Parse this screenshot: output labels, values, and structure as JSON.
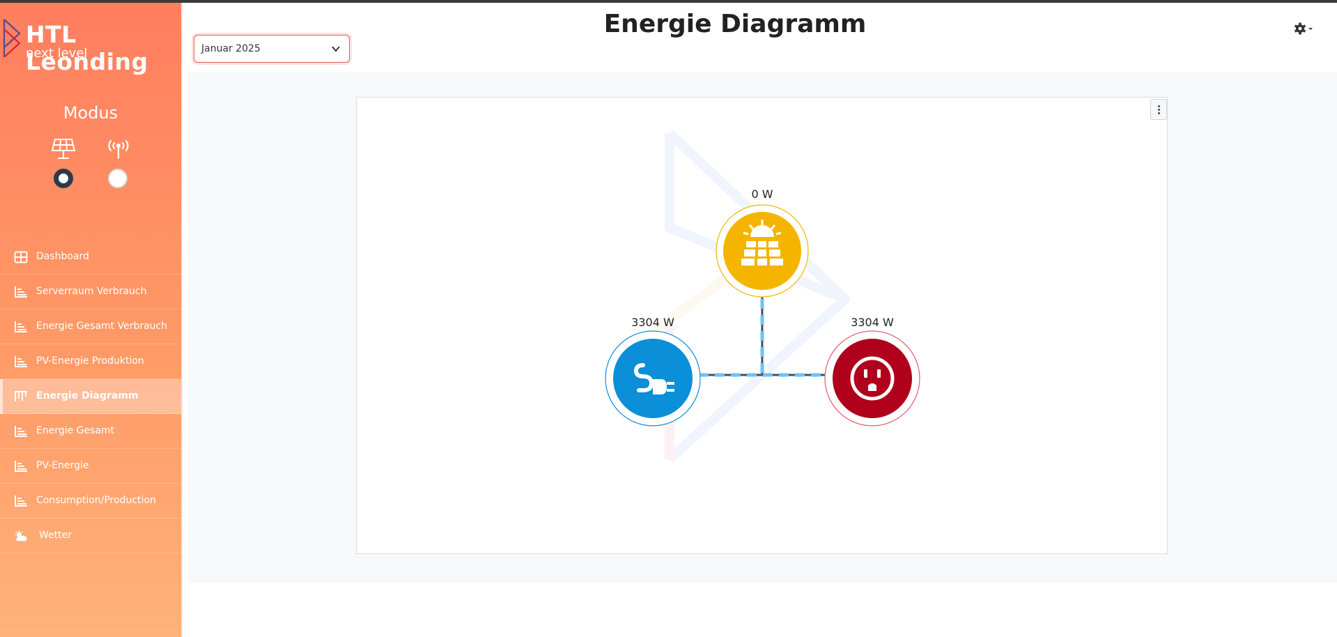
{
  "brand": {
    "name": "HTL Leonding",
    "tagline": "next level"
  },
  "mode": {
    "title": "Modus",
    "options": [
      {
        "icon": "solar-panel-icon",
        "checked": true
      },
      {
        "icon": "broadcast-tower-icon",
        "checked": false
      }
    ]
  },
  "nav": {
    "items": [
      {
        "label": "Dashboard",
        "icon": "grid-icon",
        "active": false
      },
      {
        "label": "Serverraum Verbrauch",
        "icon": "bar-chart-icon",
        "active": false
      },
      {
        "label": "Energie Gesamt Verbrauch",
        "icon": "bar-chart-icon",
        "active": false
      },
      {
        "label": "PV-Energie Produktion",
        "icon": "bar-chart-icon",
        "active": false
      },
      {
        "label": "Energie Diagramm",
        "icon": "flow-chart-icon",
        "active": true
      },
      {
        "label": "Energie Gesamt",
        "icon": "bar-chart-icon",
        "active": false
      },
      {
        "label": "PV-Energie",
        "icon": "bar-chart-icon",
        "active": false
      },
      {
        "label": "Consumption/Production",
        "icon": "bar-chart-icon",
        "active": false
      },
      {
        "label": "Wetter",
        "icon": "cloud-sun-icon",
        "active": false
      }
    ]
  },
  "page": {
    "title": "Energie Diagramm"
  },
  "month_select": {
    "value": "Januar 2025"
  },
  "energy_flow": {
    "pv": {
      "value": "0 W",
      "color": "#f4b400"
    },
    "grid": {
      "value": "3304 W",
      "color": "#0a8fd8"
    },
    "consumption": {
      "value": "3304 W",
      "color": "#b0001c"
    },
    "flow_color": "#6ec1f7"
  },
  "colors": {
    "sidebar_top": "#ff7e5f",
    "sidebar_bottom": "#ffb27a",
    "accent": "#e85b5b"
  }
}
